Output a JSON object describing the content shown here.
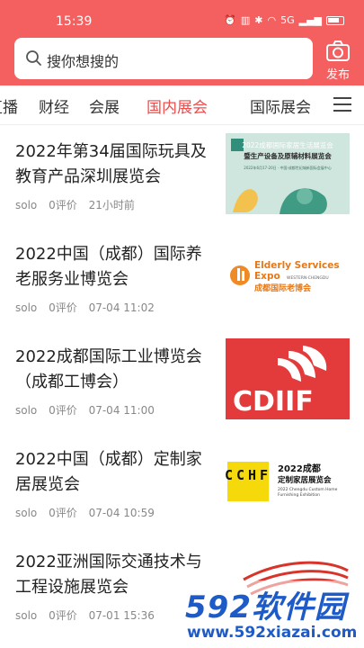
{
  "status_bar": {
    "time": "15:39",
    "signal_text": "5G",
    "battery_level": 0.7
  },
  "header": {
    "search_placeholder": "搜你想搜的",
    "publish_label": "发布"
  },
  "tabs": [
    {
      "label": "直播",
      "active": false
    },
    {
      "label": "财经",
      "active": false
    },
    {
      "label": "会展",
      "active": false
    },
    {
      "label": "国内展会",
      "active": true
    },
    {
      "label": "国际展会",
      "active": false
    }
  ],
  "articles": [
    {
      "title": "2022年第34届国际玩具及教育产品深圳展览会",
      "author": "solo",
      "reviews": "0评价",
      "time": "21小时前",
      "thumb": {
        "heading": "2022成都国际家居生活展览会",
        "sub": "暨生产设备及原辅材料展览会",
        "detail": "2022年6月17-20日 · 中国·成都世纪城新国际会展中心"
      }
    },
    {
      "title": "2022中国（成都）国际养老服务业博览会",
      "author": "solo",
      "reviews": "0评价",
      "time": "07-04 11:02",
      "thumb": {
        "line1": "Elderly Services",
        "line2": "Expo",
        "line3": "WESTERN·CHENGDU",
        "line4": "成都国际老博会"
      }
    },
    {
      "title": "2022成都国际工业博览会（成都工博会）",
      "author": "solo",
      "reviews": "0评价",
      "time": "07-04 11:00",
      "thumb": {
        "logo_text": "CDIIF"
      }
    },
    {
      "title": "2022中国（成都）定制家居展览会",
      "author": "solo",
      "reviews": "0评价",
      "time": "07-04 10:59",
      "thumb": {
        "mark": "CCHF",
        "line1": "2022成都",
        "line2": "定制家居展览会",
        "line3": "2022 Chengdu Custom Home",
        "line4": "Furnishing Exhibition"
      }
    },
    {
      "title": "2022亚洲国际交通技术与工程设施展览会",
      "author": "solo",
      "reviews": "0评价",
      "time": "07-01 15:36",
      "thumb": {}
    }
  ],
  "watermark": {
    "brand": "592软件园",
    "url": "www.592xiazai.com"
  },
  "colors": {
    "header": "#f46060",
    "active_tab": "#f04b4b",
    "meta_text": "#888888"
  }
}
